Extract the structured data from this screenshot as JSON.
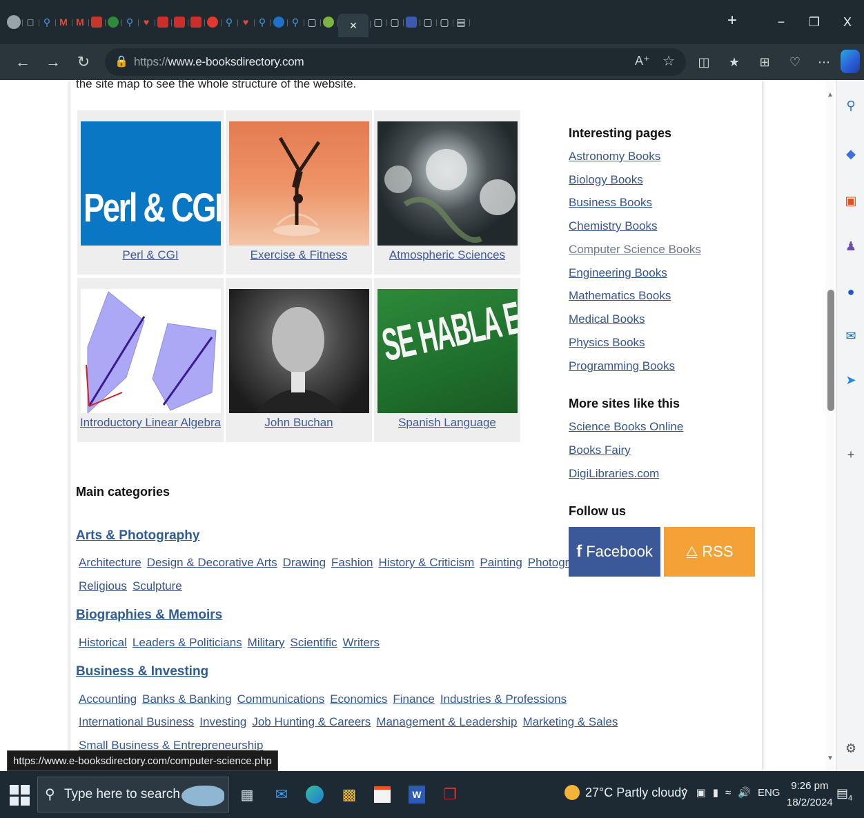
{
  "browser": {
    "url_protocol": "https://",
    "url_host": "www.e-booksdirectory.com",
    "read_aloud_label": "A̅",
    "window": {
      "minimize": "−",
      "restore": "❐",
      "close": "X"
    },
    "new_tab": "+"
  },
  "page": {
    "intro_text": "the site map to see the whole structure of the website.",
    "featured": [
      {
        "label": "Perl & CGI",
        "image_text": "Perl & CGI"
      },
      {
        "label": "Exercise & Fitness"
      },
      {
        "label": "Atmospheric Sciences"
      },
      {
        "label": "Introductory Linear Algebra"
      },
      {
        "label": "John Buchan"
      },
      {
        "label": "Spanish Language",
        "image_text": "SE HABLA ESPAÑO"
      }
    ],
    "main_categories_title": "Main categories",
    "categories": [
      {
        "name": "Arts & Photography",
        "rows": [
          [
            "Architecture",
            "Design & Decorative Arts",
            "Drawing",
            "Fashion",
            "History & Criticism",
            "Painting",
            "Photography"
          ],
          [
            "Religious",
            "Sculpture"
          ]
        ]
      },
      {
        "name": "Biographies & Memoirs",
        "rows": [
          [
            "Historical",
            "Leaders & Politicians",
            "Military",
            "Scientific",
            "Writers"
          ]
        ]
      },
      {
        "name": "Business & Investing",
        "rows": [
          [
            "Accounting",
            "Banks & Banking",
            "Communications",
            "Economics",
            "Finance",
            "Industries & Professions"
          ],
          [
            "International Business",
            "Investing",
            "Job Hunting & Careers",
            "Management & Leadership",
            "Marketing & Sales"
          ],
          [
            "Small Business & Entrepreneurship"
          ]
        ]
      }
    ],
    "sidebar": {
      "interesting_title": "Interesting pages",
      "interesting_links": [
        "Astronomy Books",
        "Biology Books",
        "Business Books",
        "Chemistry Books",
        "Computer Science Books",
        "Engineering Books",
        "Mathematics Books",
        "Medical Books",
        "Physics Books",
        "Programming Books"
      ],
      "more_sites_title": "More sites like this",
      "more_sites_links": [
        "Science Books Online",
        "Books Fairy",
        "DigiLibraries.com"
      ],
      "follow_title": "Follow us",
      "facebook_label": "Facebook",
      "rss_label": "RSS"
    },
    "status_url": "https://www.e-booksdirectory.com/computer-science.php"
  },
  "taskbar": {
    "search_placeholder": "Type here to search",
    "weather": "27°C  Partly cloudy",
    "language": "ENG",
    "time": "9:26 pm",
    "date": "18/2/2024",
    "notification_count": "4"
  },
  "colors": {
    "link": "#34558f",
    "visited_link": "#6d7a8c",
    "facebook": "#3b5998",
    "rss": "#f4a235",
    "perl_bg": "#0a77c4"
  }
}
